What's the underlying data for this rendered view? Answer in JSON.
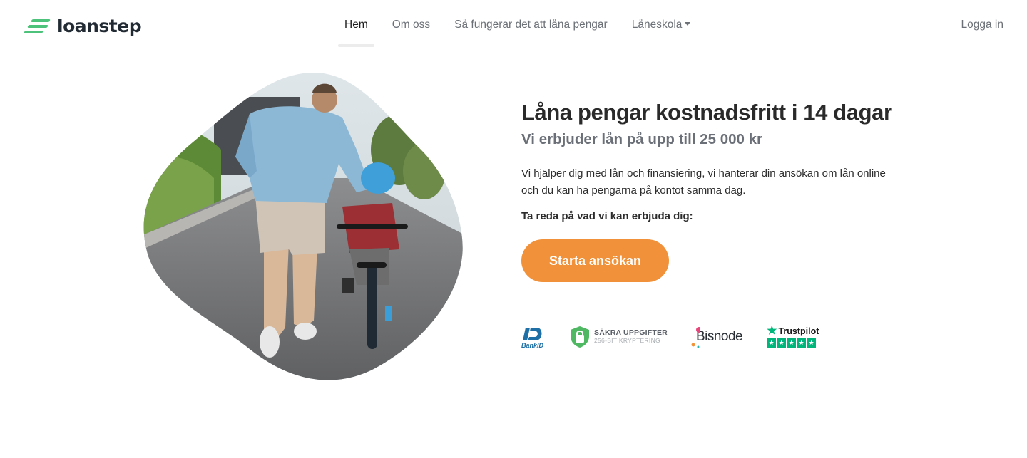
{
  "brand": {
    "name": "loanstep",
    "color": "#4cc27a"
  },
  "nav": {
    "items": [
      {
        "label": "Hem",
        "active": true
      },
      {
        "label": "Om oss",
        "active": false
      },
      {
        "label": "Så fungerar det att låna pengar",
        "active": false
      },
      {
        "label": "Låneskola",
        "active": false,
        "dropdown": true
      }
    ],
    "login_label": "Logga in"
  },
  "hero": {
    "title": "Låna pengar kostnadsfritt i 14 dagar",
    "subtitle": "Vi erbjuder lån på upp till 25 000 kr",
    "description": "Vi hjälper dig med lån och finansiering, vi hanterar din ansökan om lån online och du kan ha pengarna på kontot samma dag.",
    "cta_lead": "Ta reda på vad vi kan erbjuda dig:",
    "cta_label": "Starta ansökan",
    "cta_color": "#f1923a"
  },
  "trust": {
    "bankid": "BankID",
    "secure_line1": "SÄKRA UPPGIFTER",
    "secure_line2": "256-BIT KRYPTERING",
    "bisnode": "Bisnode",
    "trustpilot": "Trustpilot"
  }
}
